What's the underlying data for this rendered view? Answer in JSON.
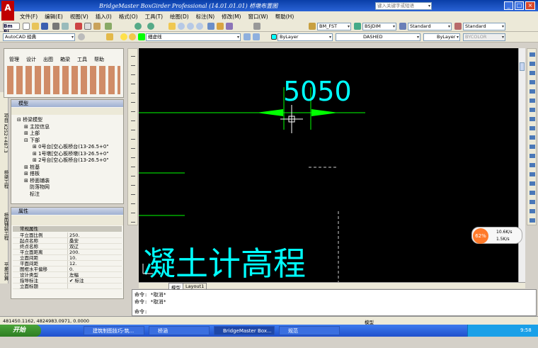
{
  "window": {
    "title": "BridgeMaster BoxGirder Professional (14.01.01.01) 桥墩布置图",
    "search_placeholder": "键入关键字或短语"
  },
  "menu": [
    "文件(F)",
    "编辑(E)",
    "视图(V)",
    "插入(I)",
    "格式(O)",
    "工具(T)",
    "绘图(D)",
    "标注(N)",
    "修改(M)",
    "窗口(W)",
    "帮助(H)"
  ],
  "toolbar": {
    "text_style": "BM_FST",
    "dim_style": "BSJDIM",
    "table_style": "Standard",
    "mleader_style": "Standard",
    "workspace": "AutoCAD 经典",
    "layer": "细虚线",
    "color": "ByLayer",
    "linetype": "DASHED",
    "lineweight": "ByLayer",
    "plotstyle": "BYCOLOR"
  },
  "bm_tabs": [
    "管理",
    "设计",
    "出图",
    "箱梁",
    "工具",
    "帮助"
  ],
  "model_panel": {
    "title": "模型",
    "tree": [
      "桥梁模型",
      "主控信息",
      "上部",
      "下部",
      "0号台[空心板桥台(13-26.5+0\"",
      "1号墩[空心板桥墩(13-26.5+0\"",
      "2号台[空心板桥台(13-26.5+0\"",
      "桩基",
      "搭板",
      "桥面铺装",
      "防落物网",
      "标注"
    ]
  },
  "props_panel": {
    "title": "属性",
    "group": "常规属性",
    "rows": [
      [
        "平立面比例",
        "250."
      ],
      [
        "起点名称",
        "桑安"
      ],
      [
        "终点名称",
        "双辽"
      ],
      [
        "平立面距离",
        "200."
      ],
      [
        "立面间距",
        "10."
      ],
      [
        "平面间距",
        "12."
      ],
      [
        "图框水平偏移",
        "0."
      ],
      [
        "设计类型",
        "左幅"
      ],
      [
        "指导标注",
        "✔ 标注"
      ],
      [
        "立面标题",
        ""
      ]
    ]
  },
  "side_tabs": [
    "项目 K252+487.3",
    "桥梁工程",
    "桥面铺装工程",
    "平差计算"
  ],
  "drawing": {
    "dim_text": "5050",
    "title_text": "凝土计高程"
  },
  "layout_tabs": [
    "模型",
    "Layout1"
  ],
  "command": {
    "lines": [
      "命令: *取消*",
      "命令: *取消*"
    ],
    "prompt": "命令:"
  },
  "status": {
    "coords": "481450.1162, 4824983.0971, 0.0000",
    "model": "模型"
  },
  "perf": {
    "percent": "62%",
    "up": "10.6K/s",
    "down": "1.5K/s"
  },
  "taskbar": {
    "start": "开始",
    "items": [
      "建筑制图技巧-筑...",
      "桥涵",
      "BridgeMaster Box...",
      "规范"
    ],
    "clock": "9:58"
  },
  "colors": {
    "dim": "#00ff00",
    "text": "#00ffff",
    "canvas": "#000000"
  }
}
